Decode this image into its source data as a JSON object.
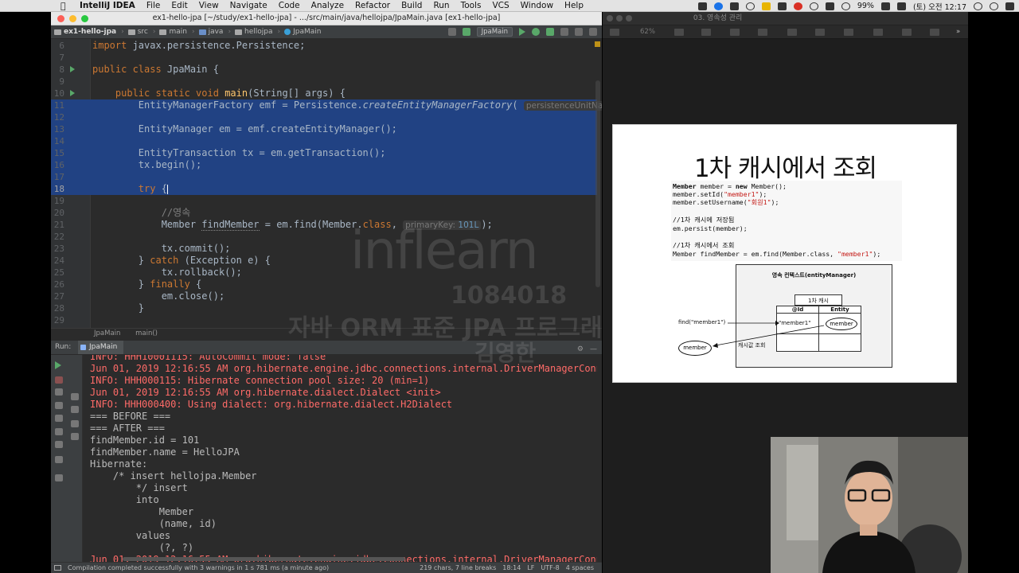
{
  "menubar": {
    "app": "IntelliJ IDEA",
    "items": [
      "File",
      "Edit",
      "View",
      "Navigate",
      "Code",
      "Analyze",
      "Refactor",
      "Build",
      "Run",
      "Tools",
      "VCS",
      "Window",
      "Help"
    ],
    "battery": "99%",
    "clock": "(토) 오전 12:17"
  },
  "ide": {
    "window_title": "ex1-hello-jpa [~/study/ex1-hello-jpa] - .../src/main/java/hellojpa/JpaMain.java [ex1-hello-jpa]",
    "breadcrumbs": [
      "ex1-hello-jpa",
      "src",
      "main",
      "java",
      "hellojpa",
      "JpaMain"
    ],
    "run_config": "JpaMain",
    "code_lines": [
      {
        "n": "6",
        "html": "<span class=\"kw\">import</span> javax.persistence.Persistence;"
      },
      {
        "n": "7",
        "html": ""
      },
      {
        "n": "8",
        "html": "<span class=\"kw\">public class</span> JpaMain {",
        "run": true
      },
      {
        "n": "9",
        "html": ""
      },
      {
        "n": "10",
        "html": "    <span class=\"kw\">public static void</span> <span class=\"fn\">main</span>(String[] args) {",
        "run": true
      },
      {
        "n": "11",
        "html": "        EntityManagerFactory emf = Persistence.<span class=\"it\">createEntityManagerFactory</span>( <span class=\"hint\">persistenceUnitName: \"hello\"</span>",
        "sel": true
      },
      {
        "n": "12",
        "html": "",
        "sel": true
      },
      {
        "n": "13",
        "html": "        EntityManager em = emf.createEntityManager();",
        "sel": true
      },
      {
        "n": "14",
        "html": "",
        "sel": true
      },
      {
        "n": "15",
        "html": "        EntityTransaction tx = em.getTransaction();",
        "sel": true
      },
      {
        "n": "16",
        "html": "        tx.begin();",
        "sel": true
      },
      {
        "n": "17",
        "html": "",
        "sel": true
      },
      {
        "n": "18",
        "html": "        <span class=\"kw\">try</span> {<span class=\"caret\"></span>",
        "sel": true,
        "cur": true
      },
      {
        "n": "19",
        "html": ""
      },
      {
        "n": "20",
        "html": "            <span class=\"cm\">//영속</span>"
      },
      {
        "n": "21",
        "html": "            Member <span class=\"unused\">findMember</span> = em.find(Member.<span class=\"kw\">class</span>, <span class=\"hint\">primaryKey: <span class=\"hint-num\">101L</span></span>);"
      },
      {
        "n": "22",
        "html": ""
      },
      {
        "n": "23",
        "html": "            tx.commit();"
      },
      {
        "n": "24",
        "html": "        } <span class=\"kw\">catch</span> (Exception e) {"
      },
      {
        "n": "25",
        "html": "            tx.rollback();"
      },
      {
        "n": "26",
        "html": "        } <span class=\"kw\">finally</span> {"
      },
      {
        "n": "27",
        "html": "            em.close();"
      },
      {
        "n": "28",
        "html": "        }"
      },
      {
        "n": "29",
        "html": ""
      }
    ],
    "editor_crumbs": [
      "JpaMain",
      "main()"
    ],
    "run_label": "Run:",
    "run_tab": "JpaMain",
    "console_lines": [
      {
        "t": "INFO: HHH10001115: AutoCommit mode: false",
        "err": true
      },
      {
        "t": "Jun 01, 2019 12:16:55 AM org.hibernate.engine.jdbc.connections.internal.DriverManagerConnectionProviderImpl",
        "err": true
      },
      {
        "t": "INFO: HHH000115: Hibernate connection pool size: 20 (min=1)",
        "err": true
      },
      {
        "t": "Jun 01, 2019 12:16:55 AM org.hibernate.dialect.Dialect <init>",
        "err": true
      },
      {
        "t": "INFO: HHH000400: Using dialect: org.hibernate.dialect.H2Dialect",
        "err": true
      },
      {
        "t": "=== BEFORE ==="
      },
      {
        "t": "=== AFTER ==="
      },
      {
        "t": "findMember.id = 101"
      },
      {
        "t": "findMember.name = HelloJPA"
      },
      {
        "t": "Hibernate:"
      },
      {
        "t": "    /* insert hellojpa.Member"
      },
      {
        "t": "        */ insert"
      },
      {
        "t": "        into"
      },
      {
        "t": "            Member"
      },
      {
        "t": "            (name, id)"
      },
      {
        "t": "        values"
      },
      {
        "t": "            (?, ?)"
      },
      {
        "t": "Jun 01, 2019 12:16:55 AM org.hibernate.engine.jdbc.connections.internal.DriverManagerConnectionProviderImpl",
        "err": true
      }
    ],
    "status_message": "Compilation completed successfully with 3 warnings in 1 s 781 ms (a minute ago)",
    "status_right": [
      "219 chars, 7 line breaks",
      "18:14",
      "LF",
      "UTF-8",
      "4 spaces"
    ]
  },
  "watermark": {
    "brand": "inflearn",
    "id": "1084018",
    "course": "자바 ORM 표준 JPA 프로그래밍 - 기본편",
    "name": "김영한"
  },
  "keynote": {
    "doc_title": "03. 영속성 관리",
    "zoom": "62%",
    "slide_title": "1차 캐시에서 조회",
    "code": [
      "Member member = new Member();",
      "member.setId(\"member1\");",
      "member.setUsername(\"회원1\");",
      "",
      "//1차 캐시에 저장됨",
      "em.persist(member);",
      "",
      "//1차 캐시에서 조회",
      "Member findMember = em.find(Member.class, \"member1\");"
    ],
    "diagram": {
      "context_title": "영속 컨텍스트(entityManager)",
      "cache_label": "1차 캐시",
      "col_id": "@Id",
      "col_entity": "Entity",
      "cell_id": "\"member1\"",
      "cell_entity": "member",
      "find_label": "find(\"member1\")",
      "result_label": "member",
      "lookup_label": "캐시값 조회"
    }
  }
}
